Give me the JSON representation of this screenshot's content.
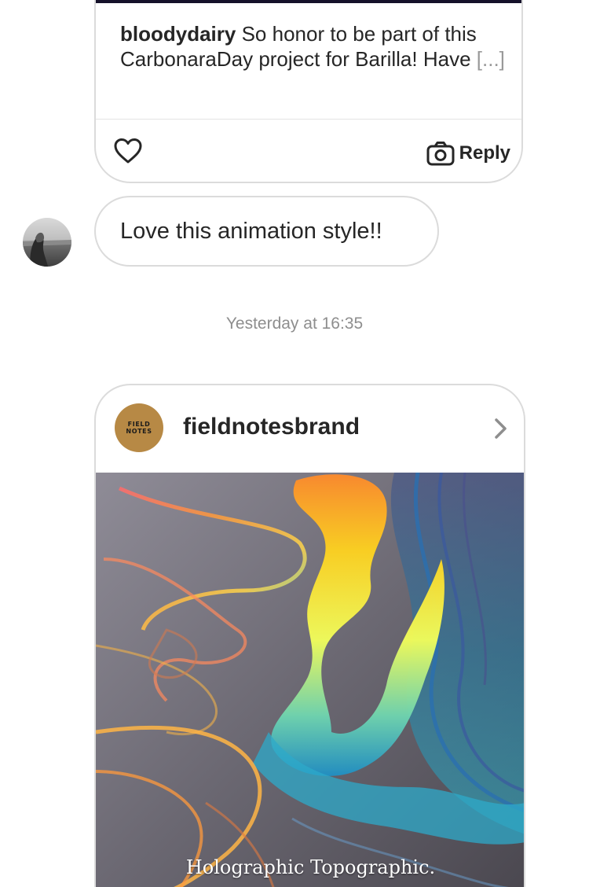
{
  "previous_message": {
    "username": "bloodydairy",
    "caption_text": "So honor to be part of this CarbonaraDay project for Barilla! Have",
    "more_marker": "[...]",
    "reply_label": "Reply"
  },
  "message": {
    "text": "Love this animation style!!"
  },
  "timestamp": "Yesterday at 16:35",
  "shared_post": {
    "username": "fieldnotesbrand",
    "logo_line1": "FIELD",
    "logo_line2": "NOTES",
    "image_caption": "Holographic Topographic."
  },
  "icons": {
    "like": "heart-icon",
    "reply": "camera-icon",
    "open_post": "chevron-right-icon"
  },
  "colors": {
    "border": "#dbdbdb",
    "text": "#262626",
    "muted": "#8e8e8e",
    "logo": "#b78945"
  }
}
